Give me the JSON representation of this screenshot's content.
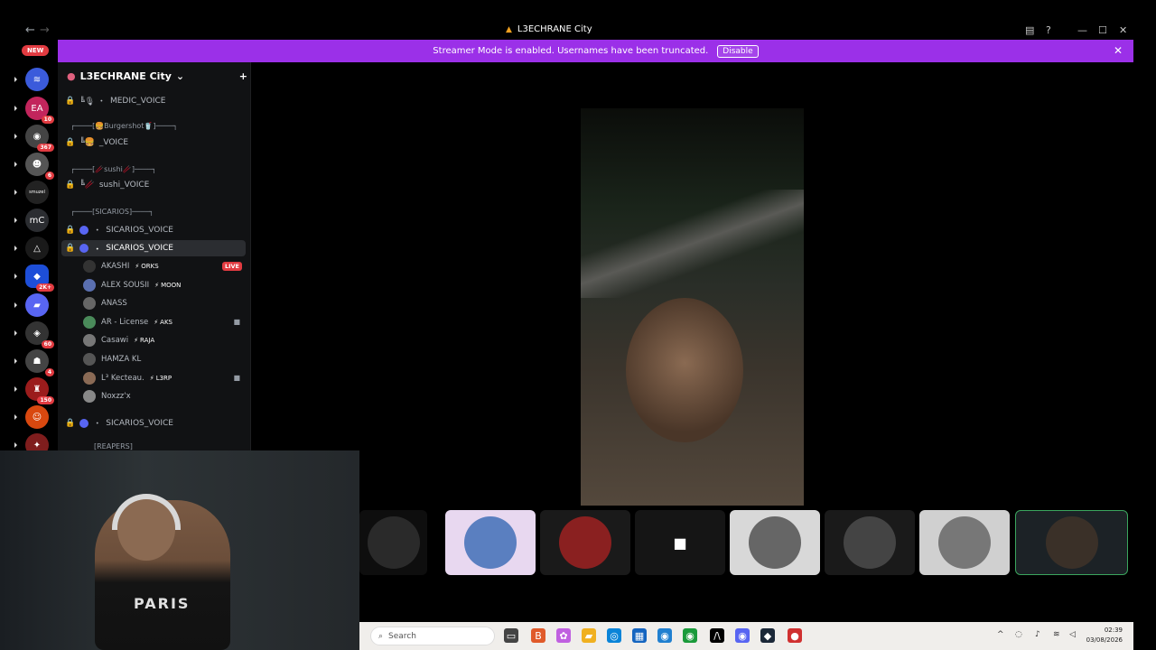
{
  "window": {
    "title": "L3ECHRANE City",
    "back": "←",
    "forward": "→",
    "controls": {
      "inbox": "▤",
      "help": "?",
      "minimize": "—",
      "maximize": "☐",
      "close": "✕"
    }
  },
  "banner": {
    "text": "Streamer Mode is enabled. Usernames have been truncated.",
    "button": "Disable",
    "close": "✕",
    "color": "#9b30e8"
  },
  "rail": {
    "new_badge": "NEW",
    "servers": [
      {
        "label": "≋",
        "badge": "",
        "color": "#3b5bdb"
      },
      {
        "label": "EA",
        "badge": "10",
        "color": "#c2255c"
      },
      {
        "label": "◉",
        "badge": "367",
        "color": "#444"
      },
      {
        "label": "☻",
        "badge": "6",
        "color": "#555"
      },
      {
        "label": "smuzel",
        "badge": "",
        "color": "#222"
      },
      {
        "label": "mC",
        "badge": "",
        "color": "#2b2d31"
      },
      {
        "label": "△",
        "badge": "",
        "color": "#1a1a1a"
      },
      {
        "label": "◆",
        "badge": "2K+",
        "color": "#1d4ed8"
      },
      {
        "label": "▰",
        "badge": "",
        "color": "#5865f2"
      },
      {
        "label": "◈",
        "badge": "60",
        "color": "#333"
      },
      {
        "label": "☗",
        "badge": "4",
        "color": "#444"
      },
      {
        "label": "♜",
        "badge": "150",
        "color": "#9b1c1c"
      },
      {
        "label": "☺",
        "badge": "",
        "color": "#d9480f"
      },
      {
        "label": "✦",
        "badge": "",
        "color": "#7f1d1d"
      }
    ]
  },
  "sidebar": {
    "server_name": "L3ECHRANE City",
    "add_member_icon": "+",
    "channels": [
      {
        "name": "MEDIC_VOICE",
        "prefix": "╚🎙 ・"
      },
      {
        "name": "┌────[🍔Burgershot🥤]────┐",
        "category": true
      },
      {
        "name": "_VOICE",
        "prefix": "╚🍔"
      },
      {
        "name": "┌────[🥢sushi🥢]────┐",
        "category": true
      },
      {
        "name": "sushi_VOICE",
        "prefix": "╚🥢"
      },
      {
        "name": "┌────[SICARIOS]────┐",
        "category": true
      },
      {
        "name": "SICARIOS_VOICE",
        "prefix": "・"
      },
      {
        "name": "SICARIOS_VOICE",
        "prefix": "・"
      },
      {
        "name": "SICARIOS_VOICE",
        "prefix": "・"
      },
      {
        "name": "[REAPERS]",
        "category": true
      }
    ],
    "users": [
      {
        "name": "AKASHI",
        "tag": "ORKS",
        "live": "LIVE"
      },
      {
        "name": "ALEX SOUSII",
        "tag": "MOON"
      },
      {
        "name": "ANASS",
        "tag": ""
      },
      {
        "name": "AR - License",
        "tag": "AKS",
        "cam": "■"
      },
      {
        "name": "Casawi",
        "tag": "RAJA"
      },
      {
        "name": "HAMZA KL",
        "tag": ""
      },
      {
        "name": "L³ Kecteau.",
        "tag": "L3RP",
        "cam": "■"
      },
      {
        "name": "Noxzz'x",
        "tag": ""
      }
    ]
  },
  "stage": {
    "tiles": [
      "avatar-1",
      "avatar-2",
      "avatar-3",
      "camera-off",
      "avatar-5",
      "avatar-6",
      "avatar-7",
      "self-video"
    ],
    "camera_off_icon": "■"
  },
  "webcam": {
    "jersey_text": "PARIS"
  },
  "taskbar": {
    "search_placeholder": "Search",
    "time": "02:39",
    "date": "03/08/2026",
    "apps": [
      "▭",
      "B",
      "✿",
      "▰",
      "◎",
      "▦",
      "◉",
      "◉",
      "/\\",
      "◉",
      "◆",
      "●"
    ]
  }
}
